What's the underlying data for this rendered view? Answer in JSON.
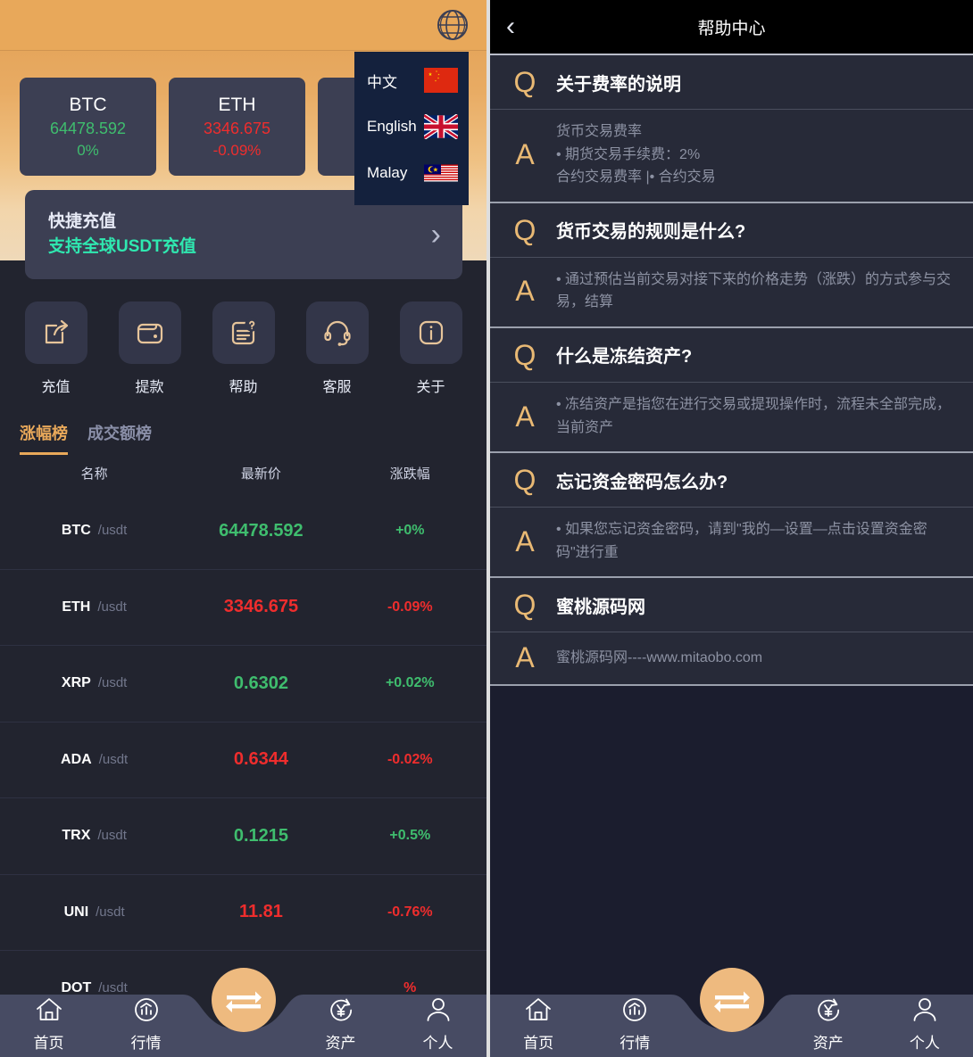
{
  "left": {
    "topbar": {
      "globe_icon": "globe-icon"
    },
    "language_menu": {
      "items": [
        {
          "label": "中文",
          "flag": "flag-china"
        },
        {
          "label": "English",
          "flag": "flag-uk"
        },
        {
          "label": "Malay",
          "flag": "flag-malaysia"
        }
      ]
    },
    "ticker_cards": [
      {
        "symbol": "BTC",
        "price": "64478.592",
        "change": "0%",
        "dir": "up"
      },
      {
        "symbol": "ETH",
        "price": "3346.675",
        "change": "-0.09%",
        "dir": "down"
      },
      {
        "symbol": "",
        "price": "",
        "change": "",
        "dir": "up"
      }
    ],
    "recharge_banner": {
      "title": "快捷充值",
      "subtitle": "支持全球USDT充值",
      "arrow": "›"
    },
    "actions": [
      {
        "label": "充值",
        "icon": "share-box-icon"
      },
      {
        "label": "提款",
        "icon": "wallet-icon"
      },
      {
        "label": "帮助",
        "icon": "document-question-icon"
      },
      {
        "label": "客服",
        "icon": "headset-icon"
      },
      {
        "label": "关于",
        "icon": "info-icon"
      }
    ],
    "rank_tabs": [
      {
        "label": "涨幅榜",
        "active": true
      },
      {
        "label": "成交额榜",
        "active": false
      }
    ],
    "list_headers": {
      "name": "名称",
      "price": "最新价",
      "change": "涨跌幅"
    },
    "coins": [
      {
        "symbol": "BTC",
        "pair": "/usdt",
        "price": "64478.592",
        "change": "+0%",
        "dir": "up"
      },
      {
        "symbol": "ETH",
        "pair": "/usdt",
        "price": "3346.675",
        "change": "-0.09%",
        "dir": "down"
      },
      {
        "symbol": "XRP",
        "pair": "/usdt",
        "price": "0.6302",
        "change": "+0.02%",
        "dir": "up"
      },
      {
        "symbol": "ADA",
        "pair": "/usdt",
        "price": "0.6344",
        "change": "-0.02%",
        "dir": "down"
      },
      {
        "symbol": "TRX",
        "pair": "/usdt",
        "price": "0.1215",
        "change": "+0.5%",
        "dir": "up"
      },
      {
        "symbol": "UNI",
        "pair": "/usdt",
        "price": "11.81",
        "change": "-0.76%",
        "dir": "down"
      },
      {
        "symbol": "DOT",
        "pair": "/usdt",
        "price": "",
        "change": "%",
        "dir": "down"
      }
    ]
  },
  "right": {
    "header": {
      "title": "帮助中心",
      "back_icon": "chevron-left-icon",
      "back_glyph": "‹"
    },
    "faq": [
      {
        "q_mark": "Q",
        "a_mark": "A",
        "question": "关于费率的说明",
        "answer": "货币交易费率\n• 期货交易手续费：2%\n合约交易费率 |• 合约交易"
      },
      {
        "q_mark": "Q",
        "a_mark": "A",
        "question": "货币交易的规则是什么?",
        "answer": "• 通过预估当前交易对接下来的价格走势（涨跌）的方式参与交易，结算"
      },
      {
        "q_mark": "Q",
        "a_mark": "A",
        "question": "什么是冻结资产?",
        "answer": "• 冻结资产是指您在进行交易或提现操作时，流程未全部完成，当前资产"
      },
      {
        "q_mark": "Q",
        "a_mark": "A",
        "question": "忘记资金密码怎么办?",
        "answer": "• 如果您忘记资金密码，请到\"我的—设置—点击设置资金密码\"进行重"
      },
      {
        "q_mark": "Q",
        "a_mark": "A",
        "question": "蜜桃源码网",
        "answer": "蜜桃源码网----www.mitaobo.com"
      }
    ]
  },
  "bottom_nav": {
    "items": [
      {
        "label": "首页",
        "icon": "home-icon"
      },
      {
        "label": "行情",
        "icon": "chart-circle-icon"
      },
      {
        "label": "资产",
        "icon": "yen-refresh-icon"
      },
      {
        "label": "个人",
        "icon": "person-icon"
      }
    ],
    "center": {
      "icon": "exchange-swap-icon"
    }
  },
  "colors": {
    "accent_orange": "#e8a85a",
    "up_green": "#3fbd6e",
    "down_red": "#ef2d2d",
    "teal": "#2fe8b0",
    "card_bg": "#3c3f53",
    "panel_bg": "#22242f",
    "faq_bg": "#272a38",
    "nav_bg": "#474b63"
  }
}
